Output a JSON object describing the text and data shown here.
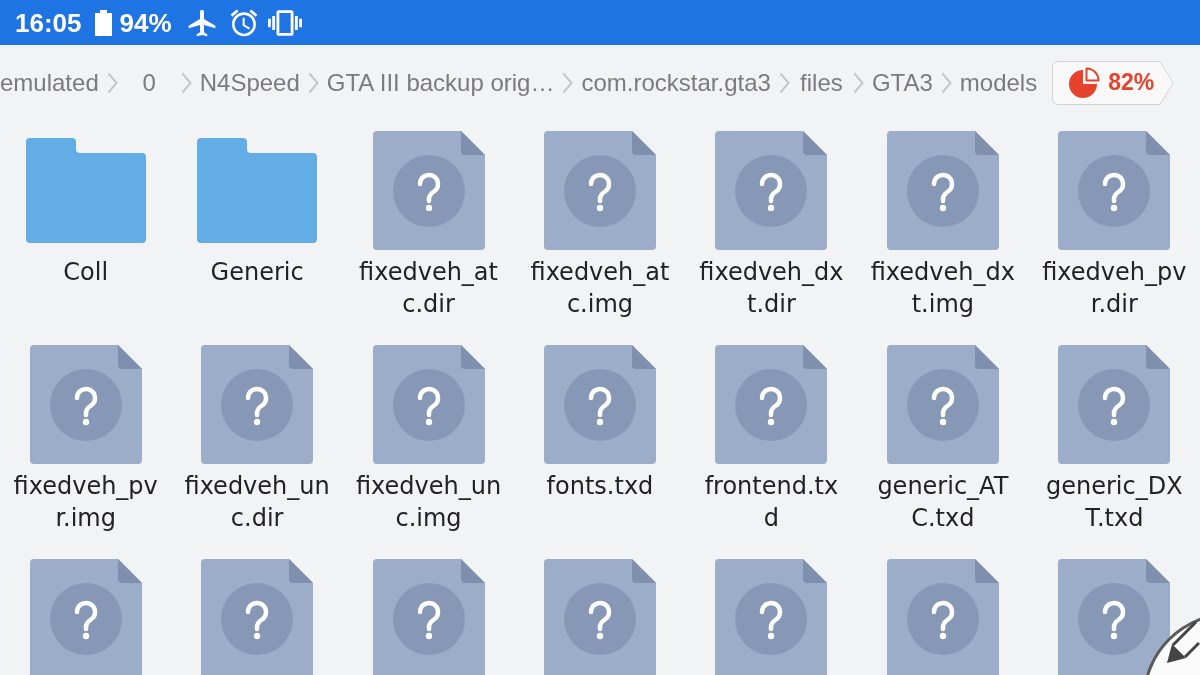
{
  "status_bar": {
    "time": "16:05",
    "battery": "94%"
  },
  "breadcrumb": [
    {
      "label": "emulated"
    },
    {
      "label": "0"
    },
    {
      "label": "N4Speed"
    },
    {
      "label": "GTA III backup orig…"
    },
    {
      "label": "com.rockstar.gta3"
    },
    {
      "label": "files"
    },
    {
      "label": "GTA3"
    },
    {
      "label": "models"
    }
  ],
  "storage": {
    "percent": "82%"
  },
  "files": [
    {
      "kind": "folder",
      "name": "Coll"
    },
    {
      "kind": "folder",
      "name": "Generic"
    },
    {
      "kind": "file",
      "name": "fixedveh_atc.dir"
    },
    {
      "kind": "file",
      "name": "fixedveh_atc.img"
    },
    {
      "kind": "file",
      "name": "fixedveh_dxt.dir"
    },
    {
      "kind": "file",
      "name": "fixedveh_dxt.img"
    },
    {
      "kind": "file",
      "name": "fixedveh_pvr.dir"
    },
    {
      "kind": "file",
      "name": "fixedveh_pvr.img"
    },
    {
      "kind": "file",
      "name": "fixedveh_unc.dir"
    },
    {
      "kind": "file",
      "name": "fixedveh_unc.img"
    },
    {
      "kind": "file",
      "name": "fonts.txd"
    },
    {
      "kind": "file",
      "name": "frontend.txd"
    },
    {
      "kind": "file",
      "name": "generic_ATC.txd"
    },
    {
      "kind": "file",
      "name": "generic_DXT.txd"
    },
    {
      "kind": "file"
    },
    {
      "kind": "file"
    },
    {
      "kind": "file"
    },
    {
      "kind": "file"
    },
    {
      "kind": "file"
    },
    {
      "kind": "file"
    },
    {
      "kind": "file"
    }
  ]
}
